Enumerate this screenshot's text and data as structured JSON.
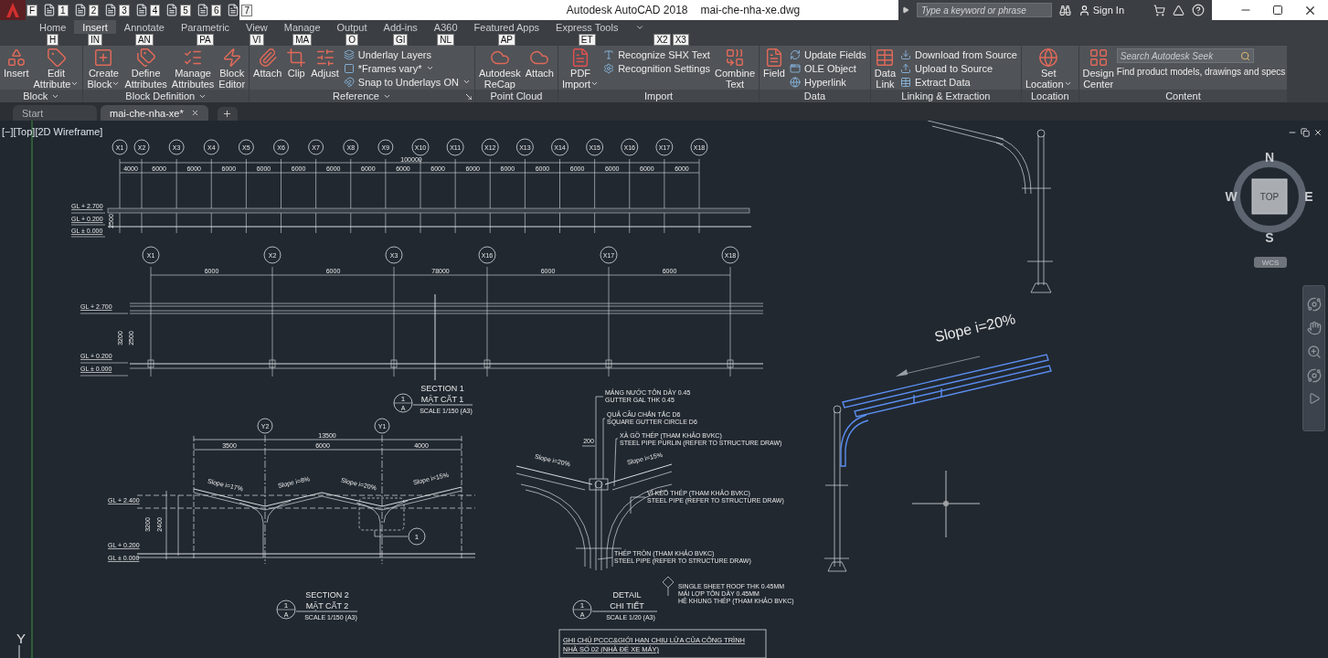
{
  "app_menu": {
    "keytip": "F"
  },
  "quick_access": [
    {
      "keytip": "1"
    },
    {
      "keytip": "2"
    },
    {
      "keytip": "3"
    },
    {
      "keytip": "4"
    },
    {
      "keytip": "5"
    },
    {
      "keytip": "6"
    },
    {
      "keytip": "7"
    }
  ],
  "title": {
    "app": "Autodesk AutoCAD 2018",
    "file": "mai-che-nha-xe.dwg"
  },
  "search": {
    "placeholder": "Type a keyword or phrase"
  },
  "sign_in": "Sign In",
  "ribbon_tabs": [
    {
      "label": "Home",
      "keytip": "H",
      "selected": false
    },
    {
      "label": "Insert",
      "keytip": "IN",
      "selected": true
    },
    {
      "label": "Annotate",
      "keytip": "AN",
      "selected": false
    },
    {
      "label": "Parametric",
      "keytip": "PA",
      "selected": false
    },
    {
      "label": "View",
      "keytip": "VI",
      "selected": false
    },
    {
      "label": "Manage",
      "keytip": "MA",
      "selected": false
    },
    {
      "label": "Output",
      "keytip": "O",
      "selected": false
    },
    {
      "label": "Add-ins",
      "keytip": "GI",
      "selected": false
    },
    {
      "label": "A360",
      "keytip": "NL",
      "selected": false
    },
    {
      "label": "Featured Apps",
      "keytip": "AP",
      "selected": false
    },
    {
      "label": "Express Tools",
      "keytip": "ET",
      "selected": false
    }
  ],
  "ribbon_toggle": {
    "keytips": [
      "X2",
      "X3"
    ]
  },
  "panels": [
    {
      "title": "Block",
      "menu": true,
      "launcher": false,
      "items": [
        {
          "kind": "large",
          "lines": [
            "Insert"
          ],
          "dropdown": false
        },
        {
          "kind": "large",
          "lines": [
            "Edit",
            "Attribute"
          ],
          "dropdown": true
        }
      ]
    },
    {
      "title": "Block Definition",
      "menu": true,
      "launcher": false,
      "items": [
        {
          "kind": "large",
          "lines": [
            "Create",
            "Block"
          ],
          "dropdown": true
        },
        {
          "kind": "large",
          "lines": [
            "Define",
            "Attributes"
          ],
          "dropdown": false
        },
        {
          "kind": "large",
          "lines": [
            "Manage",
            "Attributes"
          ],
          "dropdown": false
        },
        {
          "kind": "large",
          "lines": [
            "Block",
            "Editor"
          ],
          "dropdown": false
        }
      ]
    },
    {
      "title": "Reference",
      "menu": true,
      "launcher": true,
      "items": [
        {
          "kind": "large",
          "lines": [
            "Attach"
          ],
          "dropdown": false
        },
        {
          "kind": "large",
          "lines": [
            "Clip"
          ],
          "dropdown": false
        },
        {
          "kind": "large",
          "lines": [
            "Adjust"
          ],
          "dropdown": false
        },
        {
          "kind": "stack",
          "entries": [
            {
              "label": "Underlay Layers",
              "dropdown": false
            },
            {
              "label": "*Frames vary*",
              "dropdown": true
            },
            {
              "label": "Snap to Underlays ON",
              "dropdown": true
            }
          ]
        }
      ]
    },
    {
      "title": "Point Cloud",
      "menu": false,
      "launcher": false,
      "items": [
        {
          "kind": "large",
          "lines": [
            "Autodesk",
            "ReCap"
          ],
          "dropdown": false
        },
        {
          "kind": "large",
          "lines": [
            "Attach"
          ],
          "dropdown": false
        }
      ]
    },
    {
      "title": "Import",
      "menu": false,
      "launcher": false,
      "items": [
        {
          "kind": "large",
          "lines": [
            "PDF",
            "Import"
          ],
          "dropdown": true
        },
        {
          "kind": "stack",
          "entries": [
            {
              "label": "Recognize SHX Text",
              "dropdown": false
            },
            {
              "label": "Recognition Settings",
              "dropdown": false
            }
          ]
        },
        {
          "kind": "large",
          "lines": [
            "Combine",
            "Text"
          ],
          "dropdown": false
        }
      ]
    },
    {
      "title": "Data",
      "menu": false,
      "launcher": false,
      "items": [
        {
          "kind": "large",
          "lines": [
            "Field"
          ],
          "dropdown": false
        },
        {
          "kind": "stack",
          "entries": [
            {
              "label": "Update Fields",
              "dropdown": false
            },
            {
              "label": "OLE Object",
              "dropdown": false
            },
            {
              "label": "Hyperlink",
              "dropdown": false
            }
          ]
        }
      ]
    },
    {
      "title": "Linking & Extraction",
      "menu": false,
      "launcher": false,
      "items": [
        {
          "kind": "large",
          "lines": [
            "Data",
            "Link"
          ],
          "dropdown": false
        },
        {
          "kind": "stack",
          "entries": [
            {
              "label": "Download from Source",
              "dropdown": false
            },
            {
              "label": "Upload to Source",
              "dropdown": false
            },
            {
              "label": "Extract  Data",
              "dropdown": false
            }
          ]
        }
      ]
    },
    {
      "title": "Location",
      "menu": false,
      "launcher": false,
      "items": [
        {
          "kind": "large",
          "lines": [
            "Set",
            "Location"
          ],
          "dropdown": true
        }
      ]
    },
    {
      "title": "Content",
      "menu": false,
      "launcher": false,
      "items": [
        {
          "kind": "large",
          "lines": [
            "Design",
            "Center"
          ],
          "dropdown": false
        },
        {
          "kind": "seek",
          "placeholder": "Search Autodesk Seek",
          "caption": "Find product models, drawings and specs"
        }
      ]
    }
  ],
  "file_tabs": [
    {
      "label": "Start",
      "selected": false,
      "closable": false
    },
    {
      "label": "mai-che-nha-xe*",
      "selected": true,
      "closable": true
    }
  ],
  "viewport_label": "[−][Top][2D Wireframe]",
  "drawing": {
    "elevation_1": {
      "grid_labels": [
        "X1",
        "X2",
        "X3",
        "X4",
        "X5",
        "X6",
        "X7",
        "X8",
        "X9",
        "X10",
        "X11",
        "X12",
        "X13",
        "X14",
        "X15",
        "X16",
        "X17",
        "X18"
      ],
      "overall_dim": "100000",
      "dims": [
        "4000",
        "6000",
        "6000",
        "6000",
        "6000",
        "6000",
        "6000",
        "6000",
        "6000",
        "6000",
        "6000",
        "6000",
        "6000",
        "6000",
        "6000",
        "6000",
        "6000"
      ],
      "levels": [
        "GL + 2.700",
        "GL + 0.200",
        "GL ± 0.000"
      ],
      "height_dim": "2500"
    },
    "elevation_2": {
      "grid_labels": [
        "X1",
        "X2",
        "X3",
        "X16",
        "X17",
        "X18"
      ],
      "dims": [
        "6000",
        "6000",
        "78000",
        "6000",
        "6000"
      ],
      "levels": [
        "GL + 2.700",
        "GL + 0.200",
        "GL ± 0.000"
      ],
      "height_dims": [
        "3200",
        "2500"
      ]
    },
    "section_1": {
      "title": "SECTION 1",
      "subtitle": "MẶT CẮT 1",
      "scale": "SCALE 1/150 (A3)",
      "marker": {
        "number": "1",
        "sheet": "A"
      }
    },
    "section_2": {
      "grid_labels": [
        "Y2",
        "Y1"
      ],
      "overall_dim": "13500",
      "dims": [
        "3500",
        "6000",
        "4000"
      ],
      "slopes": [
        "Slope i=17%",
        "Slope i=8%",
        "Slope i=20%",
        "Slope i=15%"
      ],
      "levels": [
        "GL + 2.400",
        "GL + 0.200",
        "GL ± 0.000"
      ],
      "height_dims": [
        "3200",
        "2400"
      ],
      "callout": "1",
      "title": "SECTION 2",
      "subtitle": "MẶT CẮT 2",
      "scale": "SCALE 1/150 (A3)",
      "marker": {
        "number": "1",
        "sheet": "A"
      }
    },
    "detail": {
      "notes": [
        [
          "MÁNG NƯỚC TÔN DÀY 0.45",
          "GUTTER GAL THK 0.45"
        ],
        [
          "QUẢ CẦU CHẮN TẮC D6",
          "SQUARE GUTTER CIRCLE D6"
        ],
        [
          "XÀ GỒ THÉP (THAM KHẢO BVKC)",
          "STEEL PIPE PURLIN (REFER TO STRUCTURE DRAW)"
        ],
        [
          "VÌ KÈO THÉP (THAM KHẢO BVKC)",
          "STEEL PIPE (REFER TO STRUCTURE DRAW)"
        ],
        [
          "THÉP TRÒN (THAM KHẢO BVKC)",
          "STEEL PIPE (REFER TO STRUCTURE DRAW)"
        ]
      ],
      "dim": "200",
      "slopes": [
        "Slope i=20%",
        "Slope i=15%"
      ],
      "title": "DETAIL",
      "subtitle": "CHI TIẾT",
      "scale": "SCALE 1/20 (A3)",
      "marker": {
        "number": "1",
        "sheet": "A"
      },
      "roof_note": [
        "SINGLE SHEET ROOF THK 0.45MM",
        "MÁI LỢP TÔN DÀY 0.45MM",
        "HỆ KHUNG THÉP (THAM KHẢO BVKC)"
      ]
    },
    "note_box": [
      "GHI CHÚ PCCC&GIỚI HẠN CHỊU LỬA CỦA CÔNG TRÌNH",
      "NHÀ SỐ 02 (NHÀ ĐỂ XE MÁY)"
    ],
    "slope_label": "Slope i=20%"
  },
  "viewcube": {
    "north": "N",
    "south": "S",
    "east": "E",
    "west": "W",
    "face": "TOP",
    "ucs_menu": "WCS"
  },
  "ucs_label": "Y"
}
